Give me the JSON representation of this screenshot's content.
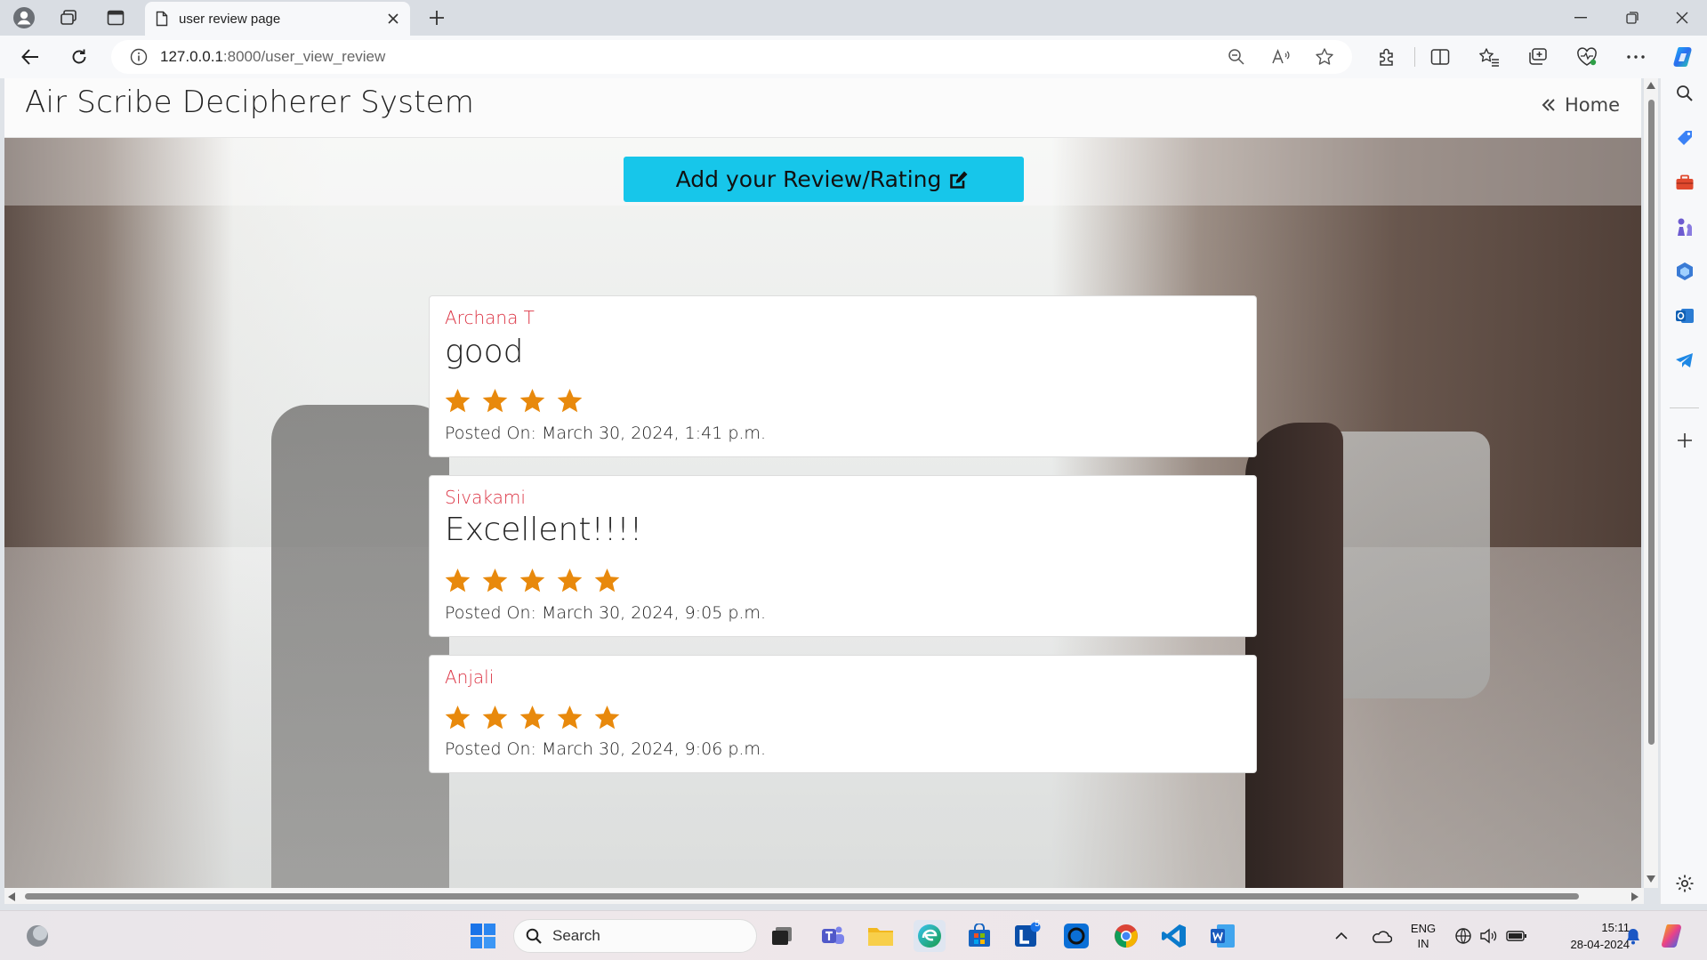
{
  "browser": {
    "tab_title": "user review page",
    "url_host": "127.0.0.1",
    "url_path": ":8000/user_view_review"
  },
  "page": {
    "brand": "Air Scribe Decipherer System",
    "home_label": "Home",
    "add_review_label": "Add your Review/Rating",
    "posted_prefix": "Posted On:"
  },
  "reviews": [
    {
      "name": "Archana T",
      "text": "good",
      "rating": 4,
      "date": "Posted On: March 30, 2024, 1:41 p.m."
    },
    {
      "name": "Sivakami",
      "text": "Excellent!!!!",
      "rating": 5,
      "date": "Posted On: March 30, 2024, 9:05 p.m."
    },
    {
      "name": "Anjali",
      "text": "",
      "rating": 5,
      "date": "Posted On: March 30, 2024, 9:06 p.m."
    }
  ],
  "colors": {
    "accent_button": "#17c6ea",
    "reviewer_name": "#dc3545",
    "star": "#e8890c"
  },
  "taskbar": {
    "search_label": "Search",
    "lang_line1": "ENG",
    "lang_line2": "IN",
    "time": "15:11",
    "date": "28-04-2024",
    "badge_count": "5"
  },
  "icons": {
    "browser": [
      "profile-icon",
      "workspaces-icon",
      "tab-actions-icon",
      "page-icon",
      "close-tab-icon",
      "new-tab-icon",
      "back-icon",
      "refresh-icon",
      "info-icon",
      "zoom-icon",
      "read-aloud-icon",
      "favorite-icon",
      "extensions-icon",
      "split-screen-icon",
      "favorites-icon",
      "collections-icon",
      "browser-essentials-icon",
      "more-icon",
      "copilot-icon"
    ],
    "sidebar": [
      "search-icon",
      "tag-icon",
      "toolbox-icon",
      "chess-icon",
      "m365-icon",
      "outlook-icon",
      "telegram-icon",
      "add-icon",
      "settings-icon"
    ]
  }
}
